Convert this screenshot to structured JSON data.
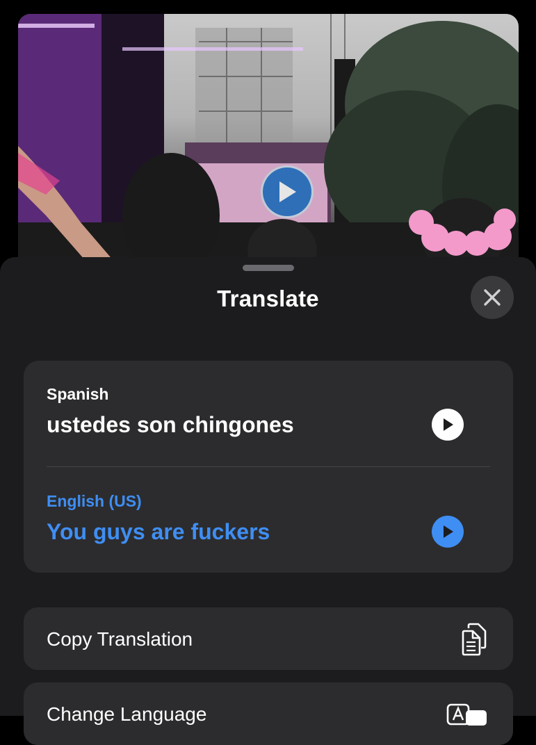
{
  "video": {
    "thumbnail_icon": "play-icon"
  },
  "sheet": {
    "title": "Translate",
    "close_icon": "close-icon",
    "source": {
      "language": "Spanish",
      "text": "ustedes son chingones",
      "speak_icon": "play-icon"
    },
    "target": {
      "language": "English (US)",
      "text": "You guys are fuckers",
      "speak_icon": "play-icon"
    },
    "actions": [
      {
        "label": "Copy Translation",
        "icon": "copy-icon"
      },
      {
        "label": "Change Language",
        "icon": "translate-icon"
      }
    ]
  },
  "colors": {
    "sheet_bg": "#1c1c1e",
    "card_bg": "#2c2c2e",
    "accent_blue": "#3f8ef3",
    "close_bg": "#3a3a3c"
  }
}
